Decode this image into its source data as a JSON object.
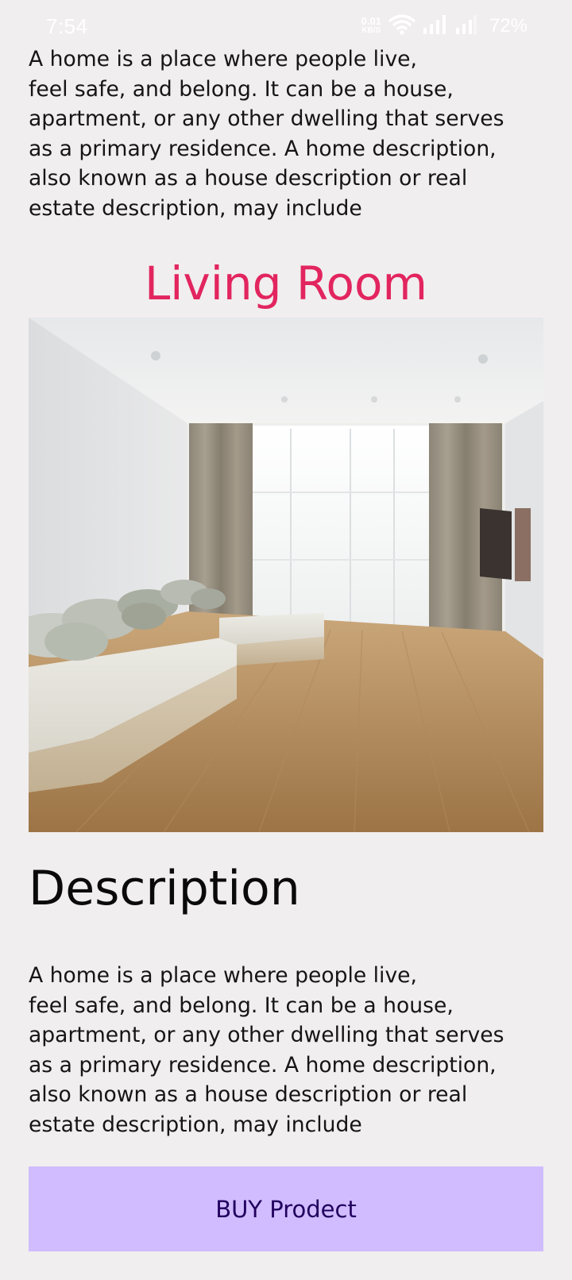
{
  "status_bar": {
    "time": "7:54",
    "net_speed_value": "0.01",
    "net_speed_unit": "KB/S",
    "battery": "72%",
    "icons": [
      "wifi-icon",
      "signal-icon",
      "signal-icon"
    ]
  },
  "intro": {
    "text": "A home is a place where people live,\nfeel safe, and belong. It can be a house,\napartment, or any other dwelling that serves\nas a primary residence. A home description,\nalso known as a house description or real\nestate description, may include"
  },
  "section_title": "Living Room",
  "photo": {
    "subject": "living room with sectional sofa, curtains and wooden floor"
  },
  "description": {
    "heading": "Description",
    "text": "A home is a place where people live,\nfeel safe, and belong. It can be a house,\napartment, or any other dwelling that serves\nas a primary residence. A home description,\nalso known as a house description or real\nestate description, may include"
  },
  "buy_button": {
    "label": "BUY Prodect"
  },
  "colors": {
    "background": "#f1eeef",
    "title_accent": "#e2255f",
    "button_bg": "#d0bcff",
    "button_text": "#21005d"
  }
}
